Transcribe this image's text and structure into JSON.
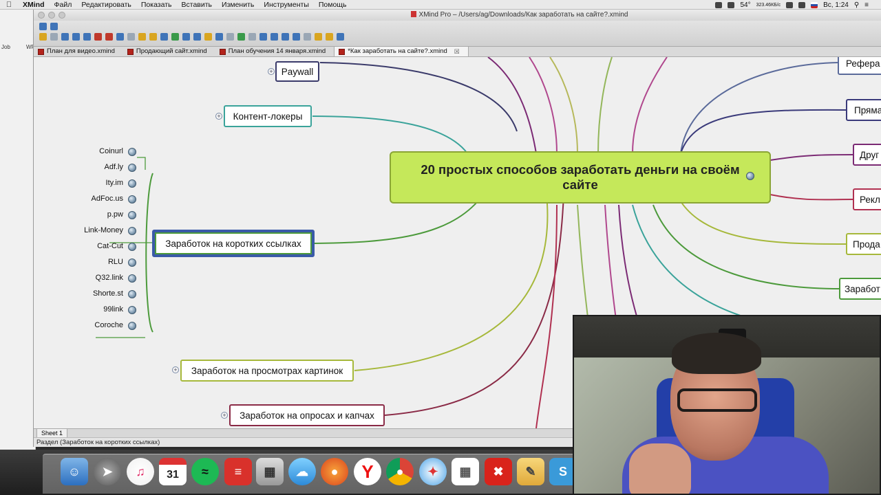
{
  "menubar": {
    "app": "XMind",
    "items": [
      "Файл",
      "Редактировать",
      "Показать",
      "Вставить",
      "Изменить",
      "Инструменты",
      "Помощь"
    ],
    "status": {
      "temp": "54°",
      "net": "323.46КБ/с",
      "day_time": "Вс, 1:24"
    }
  },
  "bgapp": {
    "labels": [
      "Job",
      "WP"
    ]
  },
  "window": {
    "title": "XMind Pro – /Users/ag/Downloads/Как заработать на сайте?.xmind"
  },
  "tabs": [
    {
      "label": "План для видео.xmind"
    },
    {
      "label": "Продающий сайт.xmind"
    },
    {
      "label": "План обучения  14 января.xmind"
    },
    {
      "label": "*Как заработать на сайте?.xmind",
      "active": true
    }
  ],
  "map": {
    "central": "20 простых способов заработать деньги на своём сайте",
    "left_topics": [
      "Paywall",
      "Контент-локеры",
      "Заработок на коротких ссылках",
      "Заработок на просмотрах картинок",
      "Заработок на опросах и капчах"
    ],
    "short_link_services": [
      "Coinurl",
      "Adf.ly",
      "Ity.im",
      "AdFoc.us",
      "p.pw",
      "Link-Money",
      "Cat-Cut",
      "RLU",
      "Q32.link",
      "Shorte.st",
      "99link",
      "Coroche"
    ],
    "right_topics": [
      "Рефера",
      "Пряма",
      "Друг",
      "Рекл",
      "Прода",
      "Заработ"
    ]
  },
  "sheet": {
    "label": "Sheet 1"
  },
  "statusbar": {
    "text": "Раздел (Заработок на коротких ссылках)"
  },
  "colors": {
    "central_fill": "#c5e85a",
    "selected_border": "#3a5aa8"
  }
}
